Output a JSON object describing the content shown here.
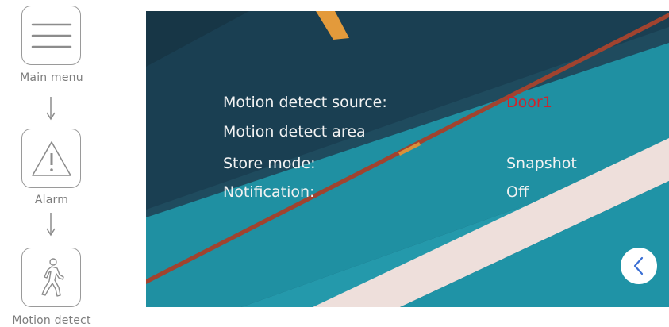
{
  "nav": {
    "items": [
      {
        "label": "Main menu",
        "icon": "menu-icon"
      },
      {
        "label": "Alarm",
        "icon": "warning-icon"
      },
      {
        "label": "Motion detect",
        "icon": "walking-person-icon"
      }
    ]
  },
  "settings": {
    "rows": [
      {
        "label": "Motion detect source:",
        "value": "Door1"
      },
      {
        "label": "Motion detect area",
        "value": ""
      },
      {
        "label": "Store mode:",
        "value": "Snapshot"
      },
      {
        "label": "Notification:",
        "value": "Off"
      }
    ]
  },
  "back_button": {
    "icon": "chevron-left-icon"
  },
  "colors": {
    "accent_value": "#d1232a",
    "text": "#f2f2f2",
    "back_chevron": "#3b6fd4",
    "nav_border": "#9a9a9a"
  }
}
